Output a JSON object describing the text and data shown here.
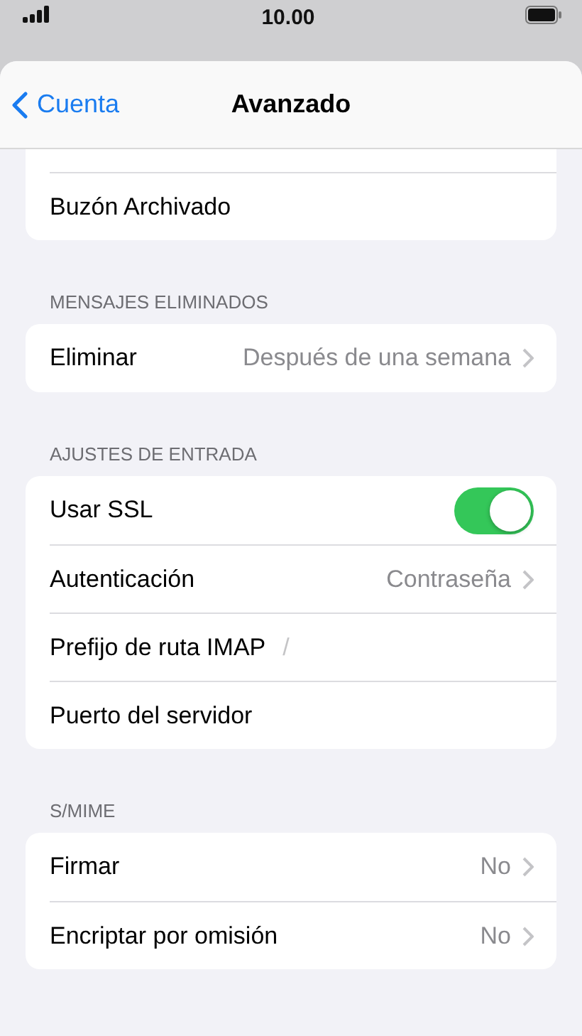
{
  "status_bar": {
    "time": "10.00"
  },
  "nav": {
    "back": "Cuenta",
    "title": "Avanzado"
  },
  "sections": [
    {
      "partial_top": true,
      "rows": [
        {
          "kind": "plain",
          "label": "Buzón Archivado"
        }
      ]
    },
    {
      "header": "MENSAJES ELIMINADOS",
      "rows": [
        {
          "kind": "value",
          "label": "Eliminar",
          "value": "Después de una semana"
        }
      ]
    },
    {
      "header": "AJUSTES DE ENTRADA",
      "rows": [
        {
          "kind": "toggle",
          "label": "Usar SSL",
          "on": true
        },
        {
          "kind": "value",
          "label": "Autenticación",
          "value": "Contraseña"
        },
        {
          "kind": "field",
          "label": "Prefijo de ruta IMAP",
          "placeholder": "/"
        },
        {
          "kind": "field",
          "label": "Puerto del servidor"
        }
      ]
    },
    {
      "header": "S/MIME",
      "rows": [
        {
          "kind": "value",
          "label": "Firmar",
          "value": "No"
        },
        {
          "kind": "value",
          "label": "Encriptar por omisión",
          "value": "No"
        }
      ]
    }
  ]
}
